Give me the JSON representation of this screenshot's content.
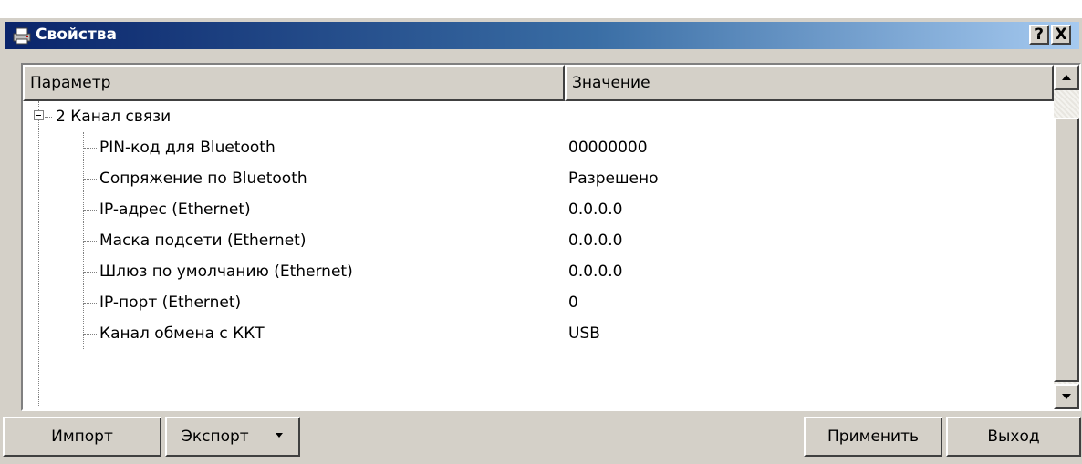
{
  "window": {
    "title": "Свойства",
    "help_label": "?",
    "close_label": "X"
  },
  "grid": {
    "columns": [
      "Параметр",
      "Значение"
    ],
    "group": {
      "label": "2 Канал связи"
    },
    "rows": [
      {
        "param": "PIN-код для Bluetooth",
        "value": "00000000"
      },
      {
        "param": "Сопряжение по Bluetooth",
        "value": "Разрешено"
      },
      {
        "param": "IP-адрес (Ethernet)",
        "value": "0.0.0.0"
      },
      {
        "param": "Маска подсети (Ethernet)",
        "value": "0.0.0.0"
      },
      {
        "param": "Шлюз по умолчанию (Ethernet)",
        "value": "0.0.0.0"
      },
      {
        "param": "IP-порт (Ethernet)",
        "value": "0"
      },
      {
        "param": "Канал обмена с ККТ",
        "value": "USB"
      }
    ]
  },
  "buttons": {
    "import": "Импорт",
    "export": "Экспорт",
    "apply": "Применить",
    "exit": "Выход"
  },
  "icons": {
    "app": "printer-icon",
    "help": "help-icon",
    "close": "close-icon",
    "scroll_up": "arrow-up-icon",
    "scroll_down": "arrow-down-icon",
    "dropdown": "caret-down-icon",
    "collapse": "minus-box-icon"
  },
  "colors": {
    "title_gradient_start": "#0a246a",
    "title_gradient_end": "#a6caf0",
    "face": "#d4d0c8"
  }
}
